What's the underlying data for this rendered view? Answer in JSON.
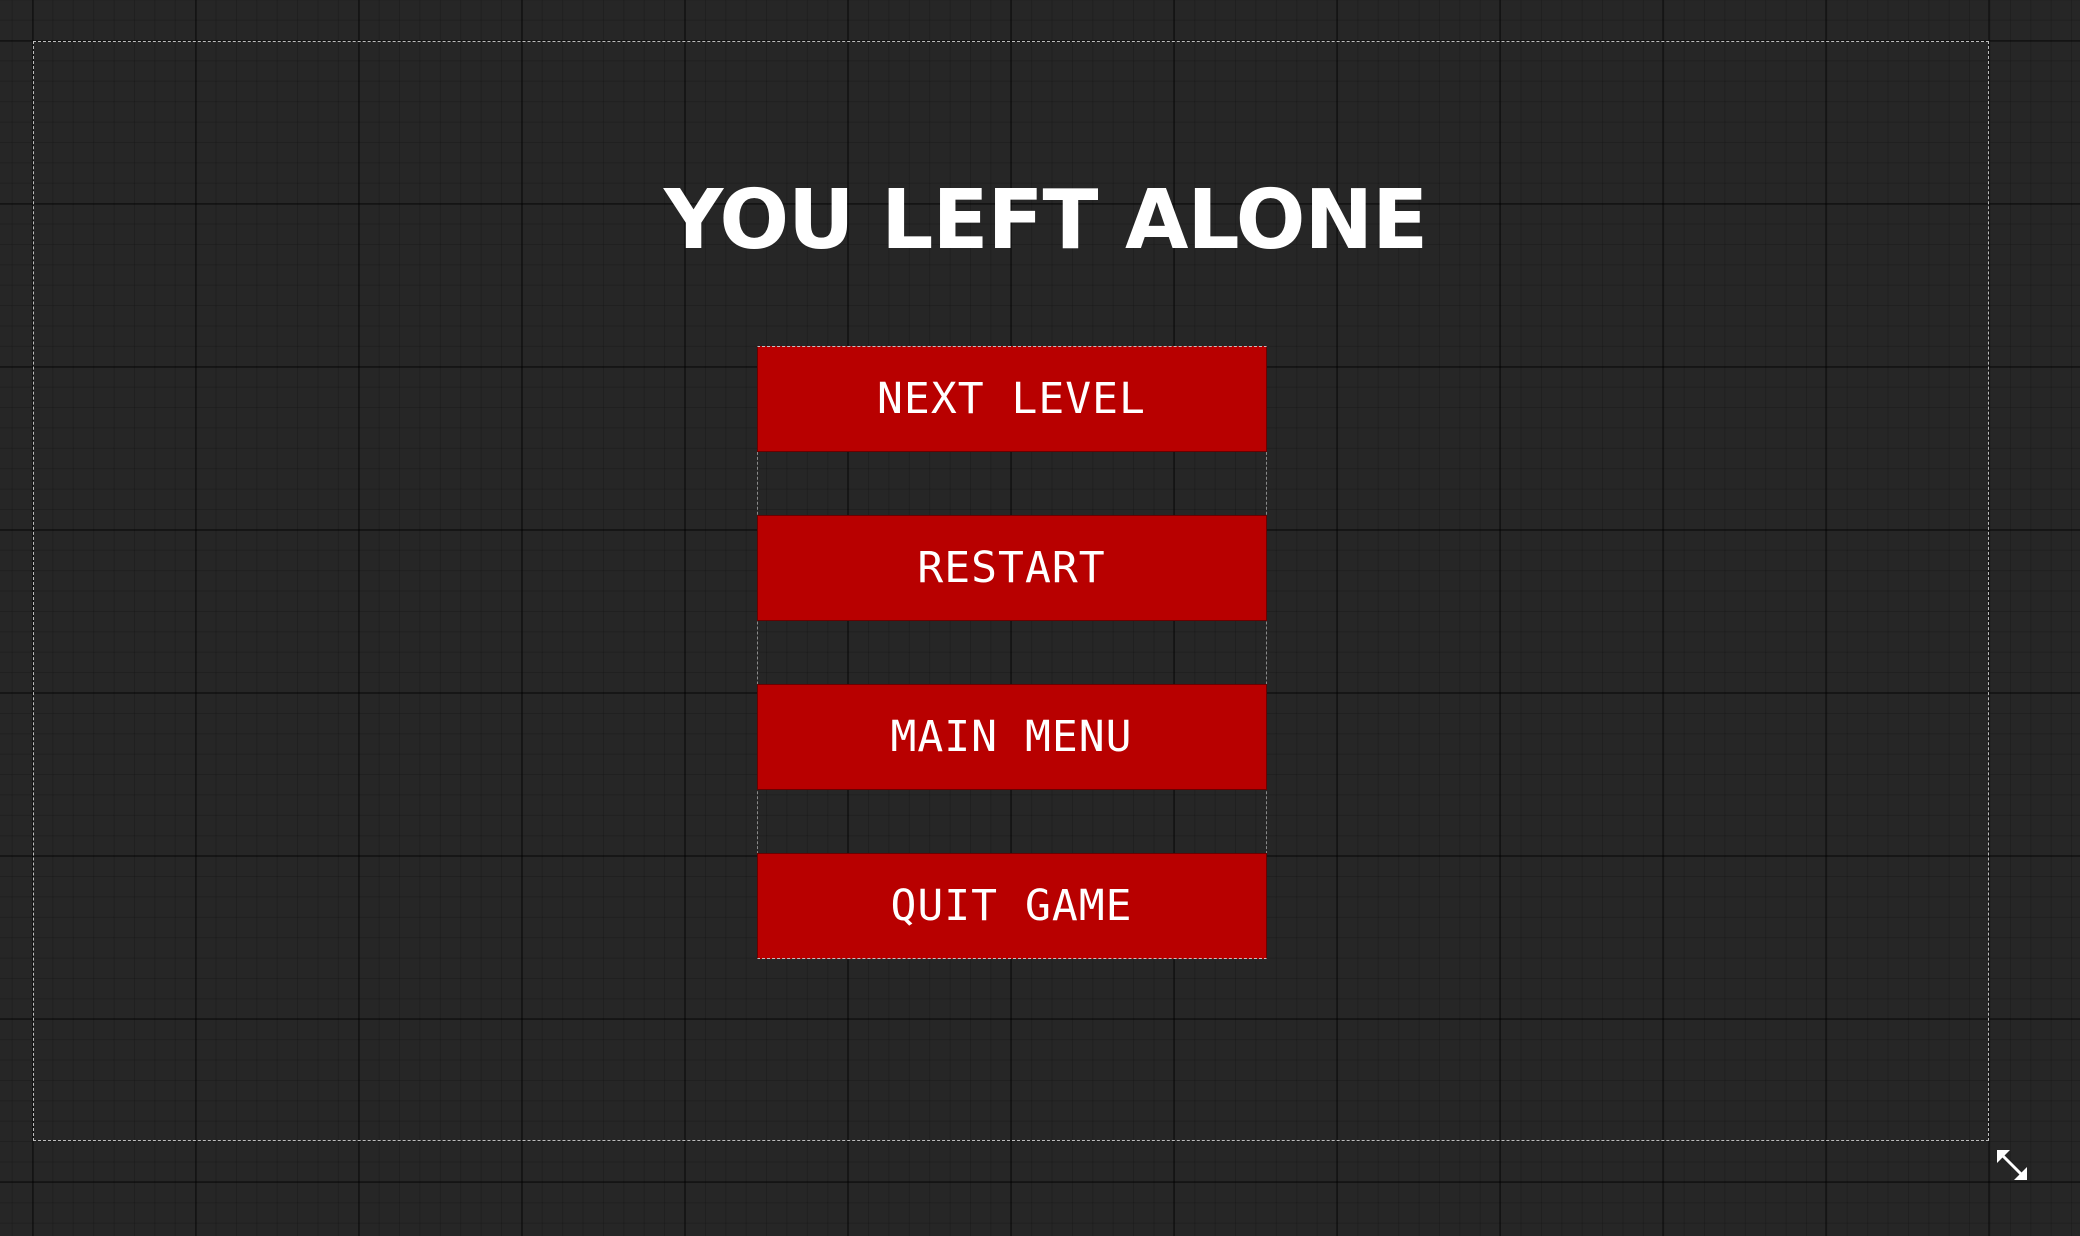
{
  "screen": {
    "title": "YOU LEFT ALONE"
  },
  "menu": {
    "buttons": [
      {
        "label": "NEXT LEVEL"
      },
      {
        "label": "RESTART"
      },
      {
        "label": "MAIN MENU"
      },
      {
        "label": "QUIT GAME"
      }
    ]
  },
  "editor": {
    "resize_icon": "resize-diagonal-icon"
  },
  "colors": {
    "background": "#262626",
    "button_fill": "#b80000",
    "text": "#ffffff"
  }
}
